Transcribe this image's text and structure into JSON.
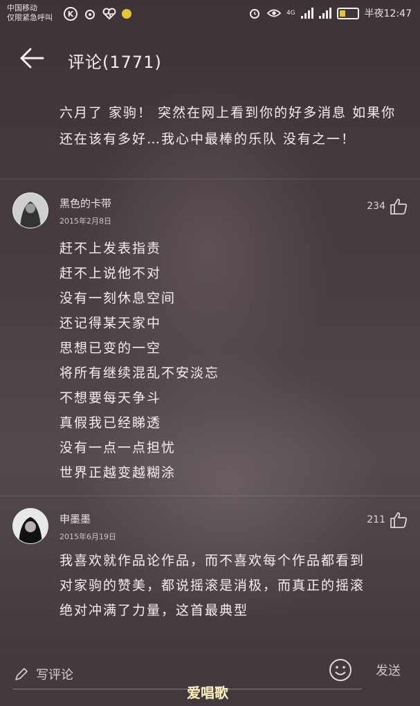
{
  "status": {
    "carrier_line1": "中国移动",
    "carrier_line2": "仅限紧急呼叫",
    "network": "4G",
    "time": "半夜12:47"
  },
  "header": {
    "title": "评论(1771)"
  },
  "comments": [
    {
      "text": "六月了 家驹！ 突然在网上看到你的好多消息 如果你还在该有多好…我心中最棒的乐队 没有之一！"
    },
    {
      "username": "黑色的卡带",
      "date": "2015年2月8日",
      "likes": "234",
      "lines": [
        "赶不上发表指责",
        "赶不上说他不对",
        "没有一刻休息空间",
        "还记得某天家中",
        "思想已变的一空",
        "将所有继续混乱不安淡忘",
        "不想要每天争斗",
        "真假我已经睇透",
        "没有一点一点担忧",
        "世界正越变越糊涂"
      ]
    },
    {
      "username": "申墨墨",
      "date": "2015年6月19日",
      "likes": "211",
      "lines": [
        "我喜欢就作品论作品，而不喜欢每个作品都看到",
        "对家驹的赞美，都说摇滚是消极，而真正的摇滚",
        "绝对冲满了力量，这首最典型"
      ]
    }
  ],
  "footer": {
    "placeholder": "写评论",
    "send_label": "发送",
    "watermark": "爱唱歌"
  },
  "colors": {
    "battery": "#e8c33a",
    "text": "#f5eef2"
  }
}
